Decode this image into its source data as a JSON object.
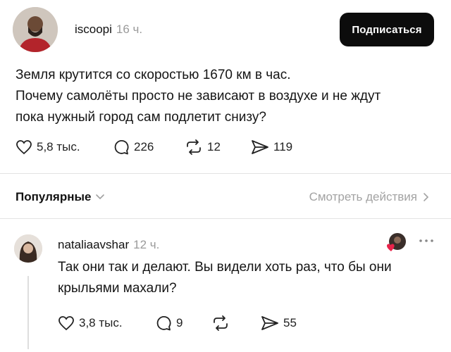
{
  "post": {
    "username": "iscoopi",
    "time": "16 ч.",
    "subscribe_label": "Подписаться",
    "text_lines": [
      "Земля крутится со скоростью 1670 км в час.",
      "Почему самолёты просто не зависают в воздухе и не ждут",
      "пока нужный город сам подлетит снизу?"
    ],
    "likes": "5,8 тыс.",
    "comments": "226",
    "reposts": "12",
    "shares": "119"
  },
  "filter": {
    "label": "Популярные",
    "view_actions_label": "Смотреть действия"
  },
  "reply": {
    "username": "nataliaavshar",
    "time": "12 ч.",
    "text_lines": [
      "Так они так и делают. Вы видели хоть раз, что бы они",
      "крыльями махали?"
    ],
    "likes": "3,8 тыс.",
    "comments": "9",
    "reposts": "",
    "shares": "55"
  },
  "colors": {
    "accent": "#0c0c0c",
    "muted": "#9a9a9a",
    "heart": "#e8234a"
  },
  "icons": [
    "heart-icon",
    "comment-icon",
    "repost-icon",
    "share-icon",
    "chevron-down-icon",
    "chevron-right-icon",
    "more-icon"
  ]
}
